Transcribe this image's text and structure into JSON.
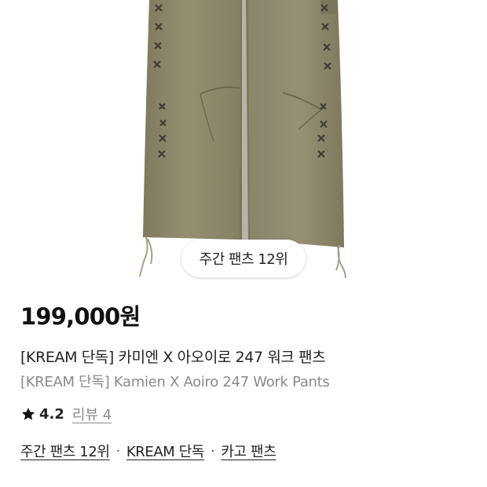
{
  "product": {
    "rank_badge": "주간 팬츠 12위",
    "price": "199,000원",
    "title_ko": "[KREAM 단독] 카미엔 X 아오이로 247 워크 팬츠",
    "title_en": "[KREAM 단독] Kamien X Aoiro 247 Work Pants",
    "rating": "4.2",
    "review_label": "리뷰 4",
    "tags": [
      "주간 팬츠 12위",
      "KREAM 단독",
      "카고 팬츠"
    ],
    "tag_separator": "·"
  },
  "colors": {
    "fabric": "#8f8a6c",
    "fabric_shadow": "#7d785c",
    "stitch": "#3f3c33",
    "muted_text": "#8a8a8a"
  },
  "icons": {
    "rating": "star-icon"
  }
}
